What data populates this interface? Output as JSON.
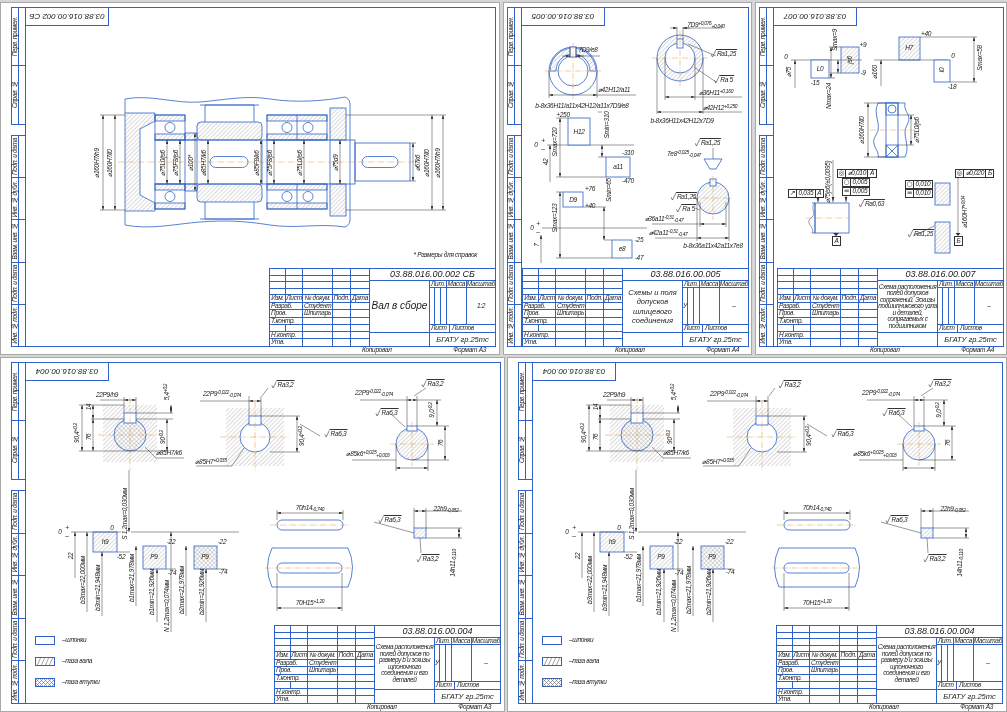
{
  "sheets": [
    {
      "kind": "assembly",
      "side_strip": [
        "Перв. примен.",
        "Справ. №",
        "Подп. и дата",
        "Инв. № дубл.",
        "Взам. инв. №",
        "Подп. и дата",
        "Инв. № подл."
      ],
      "stamp": "03.88.016.00.002 СБ",
      "labels": [
        {
          "kind": "dimension",
          "text": "⌀160H7/h9"
        },
        {
          "kind": "dimension",
          "text": "⌀160H7/l0"
        },
        {
          "kind": "dimension",
          "text": "⌀75L0/js6"
        },
        {
          "kind": "dimension",
          "text": "⌀75F8/js6"
        },
        {
          "kind": "dimension",
          "text": "⌀100*"
        },
        {
          "kind": "dimension",
          "text": "⌀85H7/k6"
        },
        {
          "kind": "dimension",
          "text": "⌀85F8/k6"
        },
        {
          "kind": "dimension",
          "text": "⌀75F8/js6"
        },
        {
          "kind": "dimension",
          "text": "⌀75L0/js6"
        },
        {
          "kind": "dimension",
          "text": "⌀75d9"
        },
        {
          "kind": "dimension",
          "text": "⌀67k6"
        },
        {
          "kind": "dimension",
          "text": "⌀160H7/l0"
        },
        {
          "kind": "dimension",
          "text": "⌀160H7/h9"
        }
      ],
      "note": "* Размеры для справок",
      "title_block": {
        "designation": "03.88.016.00.002 СБ",
        "title": "Вал в сборе",
        "header": [
          "Изм.",
          "Лист",
          "№ докум.",
          "Подп.",
          "Дата"
        ],
        "roles": [
          {
            "role": "Разраб.",
            "name": "Студент"
          },
          {
            "role": "Пров.",
            "name": "Шпитарь"
          },
          {
            "role": "Т.контр."
          },
          {
            "role": "Н.контр."
          },
          {
            "role": "Утв."
          }
        ],
        "columns": [
          "Лит.",
          "Масса",
          "Масштаб"
        ],
        "scale": "1:2",
        "sheet_field": "Лист",
        "sheets_field": "Листов",
        "org": "БГАТУ гр.25тс"
      },
      "copied": "Копировал",
      "format": "Формат A3"
    },
    {
      "kind": "spline",
      "side_strip": [
        "Перв. примен.",
        "Справ. №",
        "Подп. и дата",
        "Инв. № дубл.",
        "Взам. инв. №",
        "Подп. и дата",
        "Инв. № подл."
      ],
      "stamp": "03.88.016.00.005",
      "labels": [
        {
          "kind": "dimension",
          "text": "7D9/e8"
        },
        {
          "kind": "dimension",
          "text": "⌀42H12/a11"
        },
        {
          "kind": "caption",
          "text": "b-8x36H11/a11x42H12/a11x7D9/e8"
        },
        {
          "kind": "dimension",
          "text": "7D9$^{+0,076}$$_{+0,040}$"
        },
        {
          "kind": "roughness",
          "text": "Ra1,25"
        },
        {
          "kind": "roughness",
          "text": "Ra 5"
        },
        {
          "kind": "dimension",
          "text": "⌀36H11$^{+0,160}$"
        },
        {
          "kind": "dimension",
          "text": "⌀42H12$^{+0,250}$"
        },
        {
          "kind": "deviation",
          "text": "+250"
        },
        {
          "kind": "caption",
          "text": "b-8x36H11x42H12x7D9"
        },
        {
          "kind": "field",
          "text": "H12"
        },
        {
          "kind": "dimension",
          "text": "Smax=720"
        },
        {
          "kind": "dimension",
          "text": "Smin=310"
        },
        {
          "kind": "deviation",
          "text": "0"
        },
        {
          "kind": "deviation",
          "text": "+"
        },
        {
          "kind": "deviation",
          "text": "–"
        },
        {
          "kind": "dimension",
          "text": "42"
        },
        {
          "kind": "deviation",
          "text": "-310"
        },
        {
          "kind": "field",
          "text": "a11"
        },
        {
          "kind": "deviation",
          "text": "-470"
        },
        {
          "kind": "deviation",
          "text": "+76"
        },
        {
          "kind": "field",
          "text": "D9"
        },
        {
          "kind": "deviation",
          "text": "+40"
        },
        {
          "kind": "dimension",
          "text": "Smin=65"
        },
        {
          "kind": "dimension",
          "text": "Smax=123"
        },
        {
          "kind": "deviation",
          "text": "0"
        },
        {
          "kind": "deviation",
          "text": "+"
        },
        {
          "kind": "deviation",
          "text": "–"
        },
        {
          "kind": "dimension",
          "text": "7"
        },
        {
          "kind": "field",
          "text": "e8"
        },
        {
          "kind": "deviation",
          "text": "-25"
        },
        {
          "kind": "deviation",
          "text": "-47"
        },
        {
          "kind": "roughness",
          "text": "Ra1,25"
        },
        {
          "kind": "dimension",
          "text": "7e8$^{-0,025}$$_{-0,047}$"
        },
        {
          "kind": "roughness",
          "text": "Ra1,25"
        },
        {
          "kind": "roughness",
          "text": "Ra 5"
        },
        {
          "kind": "dimension",
          "text": "⌀36a11$^{-0,31}$$_{-0,47}$"
        },
        {
          "kind": "dimension",
          "text": "⌀42a11$^{-0,31}$$_{-0,47}$"
        },
        {
          "kind": "caption",
          "text": "b-8x36a11x42a11x7e8"
        }
      ],
      "title_block": {
        "designation": "03.88.016.00.005",
        "title": "Схемы и поля допусков шлицевого соединения",
        "header": [
          "Изм.",
          "Лист",
          "№ докум.",
          "Подп.",
          "Дата"
        ],
        "roles": [
          {
            "role": "Разраб.",
            "name": "Студент"
          },
          {
            "role": "Пров.",
            "name": "Шпитарь"
          },
          {
            "role": "Т.контр."
          },
          {
            "role": "Н.контр."
          },
          {
            "role": "Утв."
          }
        ],
        "columns": [
          "Лит.",
          "Масса",
          "Масштаб"
        ],
        "letter": "У",
        "scale": "–",
        "sheet_field": "Лист",
        "sheets_field": "Листов",
        "org": "БГАТУ гр.25тс"
      },
      "copied": "Копировал",
      "format": "Формат A4"
    },
    {
      "kind": "bearing",
      "side_strip": [
        "Перв. примен.",
        "Справ. №",
        "Подп. и дата",
        "Инв. № дубл.",
        "Взам. инв. №",
        "Подп. и дата",
        "Инв. № подл."
      ],
      "stamp": "03.88.016.00.007",
      "labels": [
        {
          "kind": "deviation",
          "text": "0"
        },
        {
          "kind": "dimension",
          "text": "⌀75"
        },
        {
          "kind": "field",
          "text": "L0"
        },
        {
          "kind": "deviation",
          "text": "-15"
        },
        {
          "kind": "dimension",
          "text": "Smax=9"
        },
        {
          "kind": "field",
          "text": "js6"
        },
        {
          "kind": "deviation",
          "text": "+9"
        },
        {
          "kind": "deviation",
          "text": "-9"
        },
        {
          "kind": "dimension",
          "text": "Nmax=24"
        },
        {
          "kind": "deviation",
          "text": "+40"
        },
        {
          "kind": "field",
          "text": "H7"
        },
        {
          "kind": "deviation",
          "text": "0"
        },
        {
          "kind": "field",
          "text": "l0"
        },
        {
          "kind": "deviation",
          "text": "-18"
        },
        {
          "kind": "dimension",
          "text": "⌀160"
        },
        {
          "kind": "dimension",
          "text": "Smax=58"
        },
        {
          "kind": "dimension",
          "text": "⌀160H7/l0"
        },
        {
          "kind": "dimension",
          "text": "⌀75L0/js6"
        },
        {
          "kind": "dimension",
          "text": "⌀75js6(±0,0095)"
        },
        {
          "kind": "roughness",
          "text": "Ra0,63"
        },
        {
          "kind": "roughness",
          "text": "Ra1,25"
        },
        {
          "kind": "dimension",
          "text": "⌀160H7$^{+0,04}$"
        }
      ],
      "frames": [
        {
          "symbol": "◎",
          "value": "⌀0,010",
          "datum": "А"
        },
        {
          "symbol": "◎",
          "value": "⌀0,020",
          "datum": "Б"
        },
        {
          "symbol": "○",
          "value": "0,005"
        },
        {
          "symbol": "○",
          "value": "0,010"
        },
        {
          "symbol": "↗",
          "value": "0,035",
          "datum": "А"
        },
        {
          "symbol": "=",
          "value": "0,005"
        },
        {
          "symbol": "=",
          "value": "0,010"
        }
      ],
      "datums": [
        "А",
        "Б"
      ],
      "title_block": {
        "designation": "03.88.016.00.007",
        "title": "Схема расположения полей допусков сопряжений. Эскизы подшипникового узла и деталей, сопрягаемых с подшипником",
        "header": [
          "Изм.",
          "Лист",
          "№ докум.",
          "Подп.",
          "Дата"
        ],
        "roles": [
          {
            "role": "Разраб.",
            "name": "Студент"
          },
          {
            "role": "Пров.",
            "name": "Шпитарь"
          },
          {
            "role": "Т.контр."
          },
          {
            "role": "Н.контр."
          },
          {
            "role": "Утв."
          }
        ],
        "columns": [
          "Лит.",
          "Масса",
          "Масштаб"
        ],
        "scale": "–",
        "sheet_field": "Лист",
        "sheets_field": "Листов",
        "org": "БГАТУ гр.25тс"
      },
      "copied": "Копировал",
      "format": "Формат A4"
    },
    {
      "kind": "key",
      "side_strip": [
        "Перв. примен.",
        "Справ. №",
        "Подп. и дата",
        "Инв. № дубл.",
        "Взам. инв. №",
        "Подп. и дата",
        "Инв. № подл."
      ],
      "stamp": "03.88.016.00.004",
      "labels": [
        {
          "kind": "dimension",
          "text": "22P9/h9"
        },
        {
          "kind": "dimension",
          "text": "14"
        },
        {
          "kind": "dimension",
          "text": "5,4$^{+0,2}$"
        },
        {
          "kind": "dimension",
          "text": "90,4$^{+0,2}$"
        },
        {
          "kind": "dimension",
          "text": "76"
        },
        {
          "kind": "dimension",
          "text": "90$^{-0,2}$"
        },
        {
          "kind": "dimension",
          "text": "⌀85H7/k6"
        },
        {
          "kind": "dimension",
          "text": "22P9$^{-0,022}$$_{-0,074}$"
        },
        {
          "kind": "roughness",
          "text": "Ra3,2"
        },
        {
          "kind": "dimension",
          "text": "⌀85H7$^{+0,035}$"
        },
        {
          "kind": "dimension",
          "text": "90,4$^{+0,2}$"
        },
        {
          "kind": "roughness",
          "text": "Ra6,3"
        },
        {
          "kind": "dimension",
          "text": "22P9$^{-0,022}$$_{-0,074}$"
        },
        {
          "kind": "roughness",
          "text": "Ra3,2"
        },
        {
          "kind": "roughness",
          "text": "Ra6,3"
        },
        {
          "kind": "dimension",
          "text": "9,0$^{-0,2}$"
        },
        {
          "kind": "dimension",
          "text": "76"
        },
        {
          "kind": "dimension",
          "text": "⌀85k6$^{+0,025}$$_{+0,003}$"
        },
        {
          "kind": "deviation",
          "text": "0"
        },
        {
          "kind": "deviation",
          "text": "+"
        },
        {
          "kind": "deviation",
          "text": "–"
        },
        {
          "kind": "dimension",
          "text": "22"
        },
        {
          "kind": "field",
          "text": "h9"
        },
        {
          "kind": "deviation",
          "text": "0"
        },
        {
          "kind": "deviation",
          "text": "-52"
        },
        {
          "kind": "dimension",
          "text": "b3max=22,000мм"
        },
        {
          "kind": "dimension",
          "text": "b3min=21,948мм"
        },
        {
          "kind": "dimension",
          "text": "S 1,2max=0,030мм"
        },
        {
          "kind": "field",
          "text": "P9"
        },
        {
          "kind": "deviation",
          "text": "-22"
        },
        {
          "kind": "deviation",
          "text": "-74"
        },
        {
          "kind": "dimension",
          "text": "b1max=21,978мм"
        },
        {
          "kind": "dimension",
          "text": "b1min=21,926мм"
        },
        {
          "kind": "dimension",
          "text": "N 1,2max=0,074мм"
        },
        {
          "kind": "field",
          "text": "P9"
        },
        {
          "kind": "deviation",
          "text": "-22"
        },
        {
          "kind": "deviation",
          "text": "-74"
        },
        {
          "kind": "dimension",
          "text": "b2max=21,978мм"
        },
        {
          "kind": "dimension",
          "text": "b2min=21,926мм"
        },
        {
          "kind": "dimension",
          "text": "70h14$_{-0,740}$"
        },
        {
          "kind": "dimension",
          "text": "70H15$^{+1,20}$"
        },
        {
          "kind": "roughness",
          "text": "Ra6,3"
        },
        {
          "kind": "dimension",
          "text": "22h9$_{-0,052}$"
        },
        {
          "kind": "roughness",
          "text": "Ra3,2"
        },
        {
          "kind": "dimension",
          "text": "14h11$_{-0,110}$"
        }
      ],
      "legend": [
        {
          "kind": "plain",
          "label": "–шпонки"
        },
        {
          "kind": "hatch",
          "label": "–паза вала"
        },
        {
          "kind": "cross",
          "label": "–паза втулки"
        }
      ],
      "title_block": {
        "designation": "03.88.016.00.004",
        "title": "Схема расположения полей допусков по размеру b и эскизы шпоночного соединения и его деталей",
        "header": [
          "Изм.",
          "Лист",
          "№ докум.",
          "Подп.",
          "Дата"
        ],
        "roles": [
          {
            "role": "Разраб.",
            "name": "Студент"
          },
          {
            "role": "Пров.",
            "name": "Шпитарь"
          },
          {
            "role": "Т.контр."
          },
          {
            "role": "Н.контр."
          },
          {
            "role": "Утв."
          }
        ],
        "columns": [
          "Лит.",
          "Масса",
          "Масштаб"
        ],
        "letter": "У",
        "scale": "–",
        "sheet_field": "Лист",
        "sheets_field": "Листов",
        "org": "БГАТУ гр.25тс"
      },
      "copied": "Копировал",
      "format": "Формат A3"
    },
    {
      "kind": "key",
      "side_strip": [
        "Перв. примен.",
        "Справ. №",
        "Подп. и дата",
        "Инв. № дубл.",
        "Взам. инв. №",
        "Подп. и дата",
        "Инв. № подл."
      ],
      "stamp": "03.88.016.00.004",
      "labels": [
        {
          "kind": "dimension",
          "text": "22P9/h9"
        },
        {
          "kind": "dimension",
          "text": "14"
        },
        {
          "kind": "dimension",
          "text": "5,4$^{+0,2}$"
        },
        {
          "kind": "dimension",
          "text": "90,4$^{+0,2}$"
        },
        {
          "kind": "dimension",
          "text": "76"
        },
        {
          "kind": "dimension",
          "text": "90$^{-0,2}$"
        },
        {
          "kind": "dimension",
          "text": "⌀85H7/k6"
        },
        {
          "kind": "dimension",
          "text": "22P9$^{-0,022}$$_{-0,074}$"
        },
        {
          "kind": "roughness",
          "text": "Ra3,2"
        },
        {
          "kind": "dimension",
          "text": "⌀85H7$^{+0,035}$"
        },
        {
          "kind": "dimension",
          "text": "90,4$^{+0,2}$"
        },
        {
          "kind": "roughness",
          "text": "Ra6,3"
        },
        {
          "kind": "dimension",
          "text": "22P9$^{-0,022}$$_{-0,074}$"
        },
        {
          "kind": "roughness",
          "text": "Ra3,2"
        },
        {
          "kind": "roughness",
          "text": "Ra6,3"
        },
        {
          "kind": "dimension",
          "text": "9,0$^{-0,2}$"
        },
        {
          "kind": "dimension",
          "text": "76"
        },
        {
          "kind": "dimension",
          "text": "⌀85k6$^{+0,025}$$_{+0,003}$"
        },
        {
          "kind": "deviation",
          "text": "0"
        },
        {
          "kind": "deviation",
          "text": "+"
        },
        {
          "kind": "deviation",
          "text": "–"
        },
        {
          "kind": "dimension",
          "text": "22"
        },
        {
          "kind": "field",
          "text": "h9"
        },
        {
          "kind": "deviation",
          "text": "0"
        },
        {
          "kind": "deviation",
          "text": "-52"
        },
        {
          "kind": "dimension",
          "text": "b3max=22,000мм"
        },
        {
          "kind": "dimension",
          "text": "b3min=21,948мм"
        },
        {
          "kind": "dimension",
          "text": "S 1,2max=0,030мм"
        },
        {
          "kind": "field",
          "text": "P9"
        },
        {
          "kind": "deviation",
          "text": "-22"
        },
        {
          "kind": "deviation",
          "text": "-74"
        },
        {
          "kind": "dimension",
          "text": "b1max=21,978мм"
        },
        {
          "kind": "dimension",
          "text": "b1min=21,926мм"
        },
        {
          "kind": "dimension",
          "text": "N 1,2max=0,074мм"
        },
        {
          "kind": "field",
          "text": "P9"
        },
        {
          "kind": "deviation",
          "text": "-22"
        },
        {
          "kind": "deviation",
          "text": "-74"
        },
        {
          "kind": "dimension",
          "text": "b2max=21,978мм"
        },
        {
          "kind": "dimension",
          "text": "b2min=21,926мм"
        },
        {
          "kind": "dimension",
          "text": "70h14$_{-0,740}$"
        },
        {
          "kind": "dimension",
          "text": "70H15$^{+1,20}$"
        },
        {
          "kind": "roughness",
          "text": "Ra6,3"
        },
        {
          "kind": "dimension",
          "text": "22h9$_{-0,052}$"
        },
        {
          "kind": "roughness",
          "text": "Ra3,2"
        },
        {
          "kind": "dimension",
          "text": "14h11$_{-0,110}$"
        }
      ],
      "legend": [
        {
          "kind": "plain",
          "label": "–шпонки"
        },
        {
          "kind": "hatch",
          "label": "–паза вала"
        },
        {
          "kind": "cross",
          "label": "–паза втулки"
        }
      ],
      "title_block": {
        "designation": "03.88.016.00.004",
        "title": "Схема расположения полей допусков по размеру b и эскизы шпоночного соединения и его деталей",
        "header": [
          "Изм.",
          "Лист",
          "№ докум.",
          "Подп.",
          "Дата"
        ],
        "roles": [
          {
            "role": "Разраб.",
            "name": "Студент"
          },
          {
            "role": "Пров.",
            "name": "Шпитарь"
          },
          {
            "role": "Т.контр."
          },
          {
            "role": "Н.контр."
          },
          {
            "role": "Утв."
          }
        ],
        "columns": [
          "Лит.",
          "Масса",
          "Масштаб"
        ],
        "letter": "У",
        "scale": "–",
        "sheet_field": "Лист",
        "sheets_field": "Листов",
        "org": "БГАТУ гр.25тс"
      },
      "copied": "Копировал",
      "format": "Формат A3"
    }
  ]
}
